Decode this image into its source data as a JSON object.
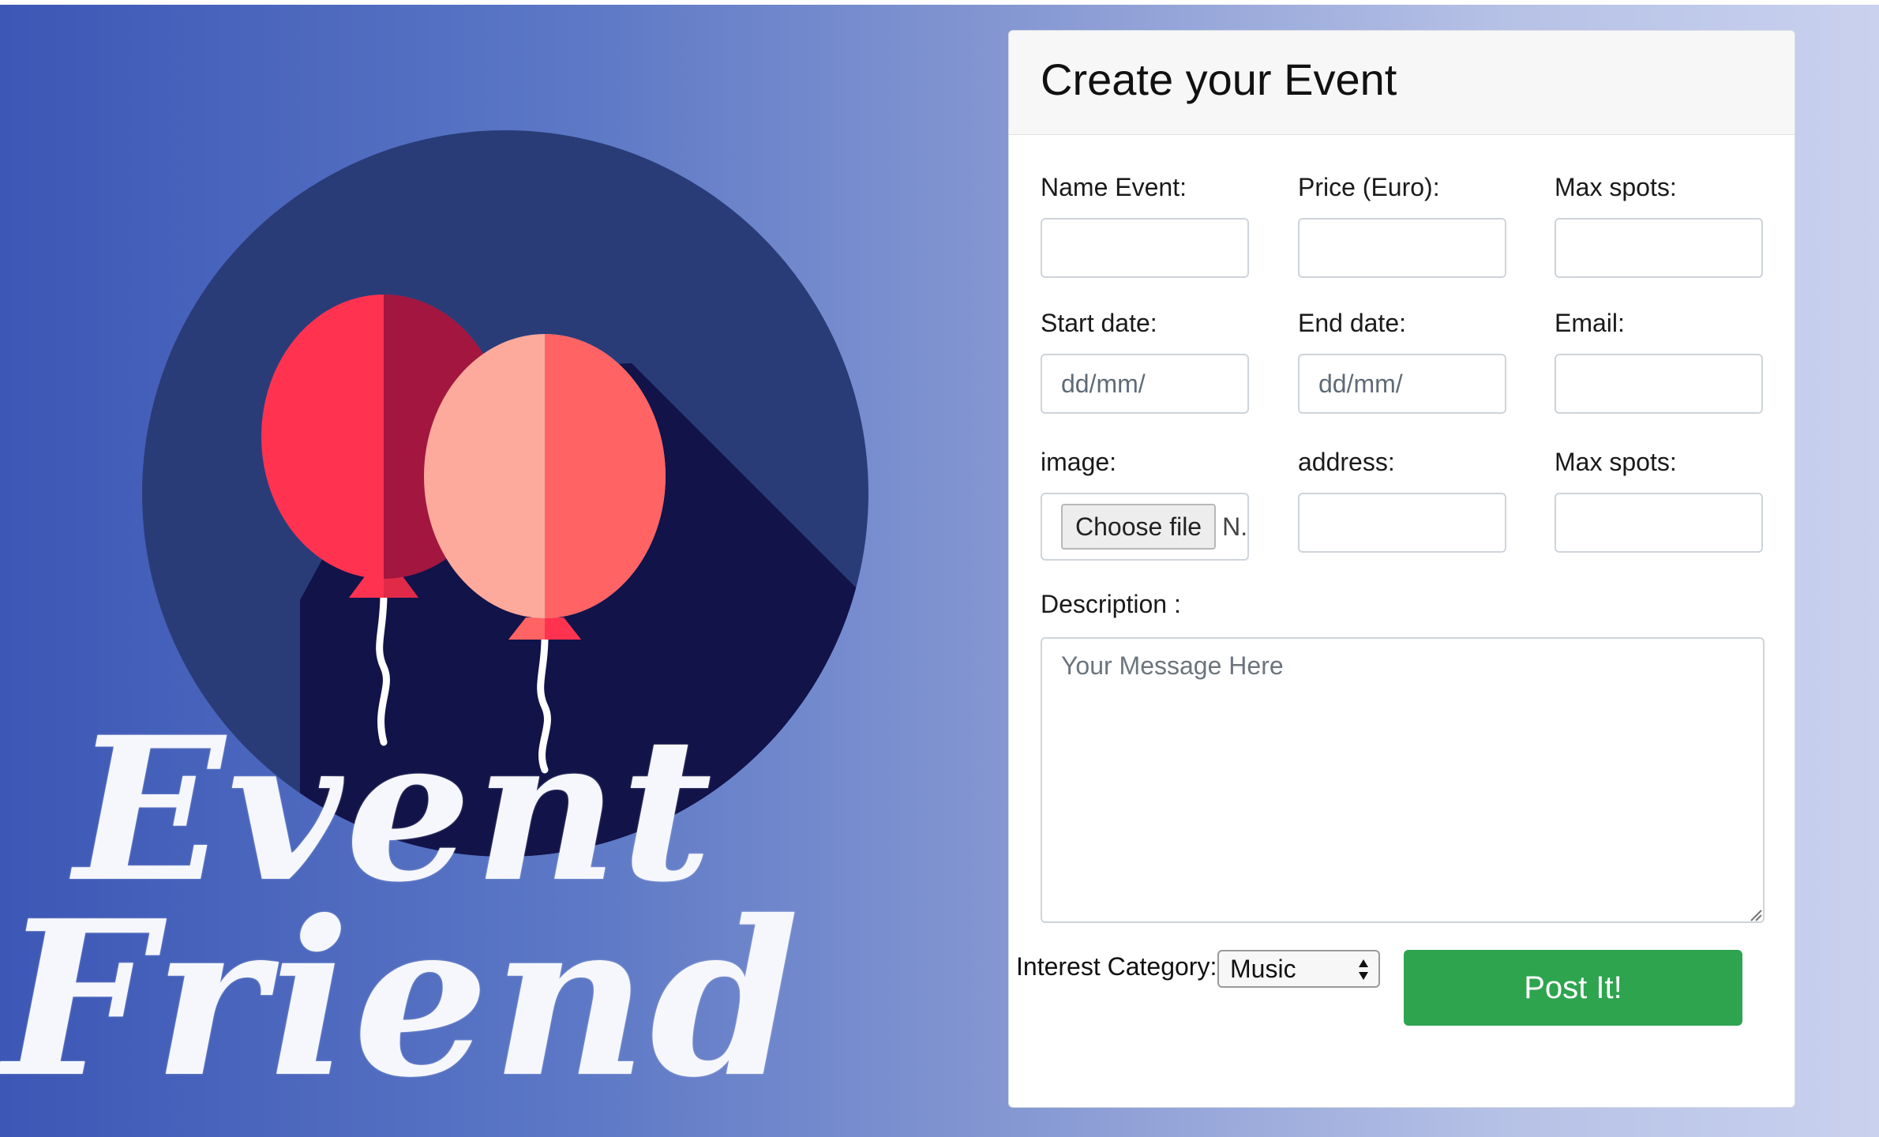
{
  "logo": {
    "wordmark_line1": "Event",
    "wordmark_line2": "Friend",
    "icon": "balloons-icon",
    "colors": {
      "circle": "#293c78",
      "shadow": "#121349",
      "balloon_left_a": "#ff3350",
      "balloon_left_b": "#a3163f",
      "balloon_right_a": "#fdaa9c",
      "balloon_right_b": "#ff6364",
      "wordmark": "#f6f7fc"
    }
  },
  "form": {
    "title": "Create your Event",
    "labels": {
      "name_event": "Name Event:",
      "price": "Price (Euro):",
      "max_spots_1": "Max spots:",
      "start_date": "Start date:",
      "end_date": "End date:",
      "email": "Email:",
      "image": "image:",
      "address": "address:",
      "max_spots_2": "Max spots:",
      "description": "Description :"
    },
    "fields": {
      "name_event": "",
      "price": "",
      "max_spots_1": "",
      "start_date": "dd/mm/",
      "end_date": "dd/mm/",
      "email": "",
      "address": "",
      "max_spots_2": ""
    },
    "file": {
      "button_label": "Choose file",
      "status": "N."
    },
    "description_placeholder": "Your Message Here",
    "category": {
      "label": "Interest Category:",
      "selected": "Music"
    },
    "submit_label": "Post It!",
    "colors": {
      "submit": "#2ea44f",
      "header_bg": "#f7f7f7"
    }
  }
}
